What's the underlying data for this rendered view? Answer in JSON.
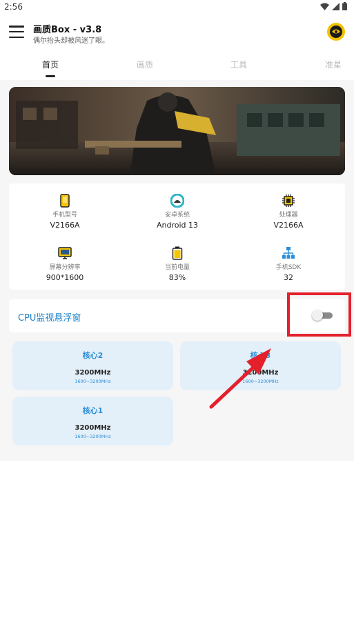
{
  "status_bar": {
    "time": "2:56",
    "icons": [
      "wifi-icon",
      "signal-icon",
      "battery-icon"
    ]
  },
  "app_bar": {
    "title": "画质Box - v3.8",
    "subtitle": "偶尔抬头却被风迷了眼。"
  },
  "tabs": [
    {
      "label": "首页",
      "active": true
    },
    {
      "label": "画质",
      "active": false
    },
    {
      "label": "工具",
      "active": false
    },
    {
      "label": "准星",
      "active": false
    }
  ],
  "device_info": [
    {
      "label": "手机型号",
      "value": "V2166A",
      "icon": "phone-icon"
    },
    {
      "label": "安卓系统",
      "value": "Android 13",
      "icon": "android-icon"
    },
    {
      "label": "处理器",
      "value": "V2166A",
      "icon": "cpu-chip-icon"
    },
    {
      "label": "屏幕分辨率",
      "value": "900*1600",
      "icon": "monitor-icon"
    },
    {
      "label": "当前电量",
      "value": "83%",
      "icon": "battery-level-icon"
    },
    {
      "label": "手机SDK",
      "value": "32",
      "icon": "hierarchy-icon"
    }
  ],
  "cpu_monitor": {
    "label": "CPU监视悬浮窗",
    "enabled": false
  },
  "cores": [
    {
      "name": "核心2",
      "freq": "3200MHz",
      "range": "1600~3200MHz"
    },
    {
      "name": "核心3",
      "freq": "3200MHz",
      "range": "1600~3200MHz"
    },
    {
      "name": "核心1",
      "freq": "3200MHz",
      "range": "1600~3200MHz"
    }
  ],
  "colors": {
    "accent": "#1b82c8",
    "core_card_bg": "#e3eff9",
    "annotation_red": "#e4202c"
  }
}
